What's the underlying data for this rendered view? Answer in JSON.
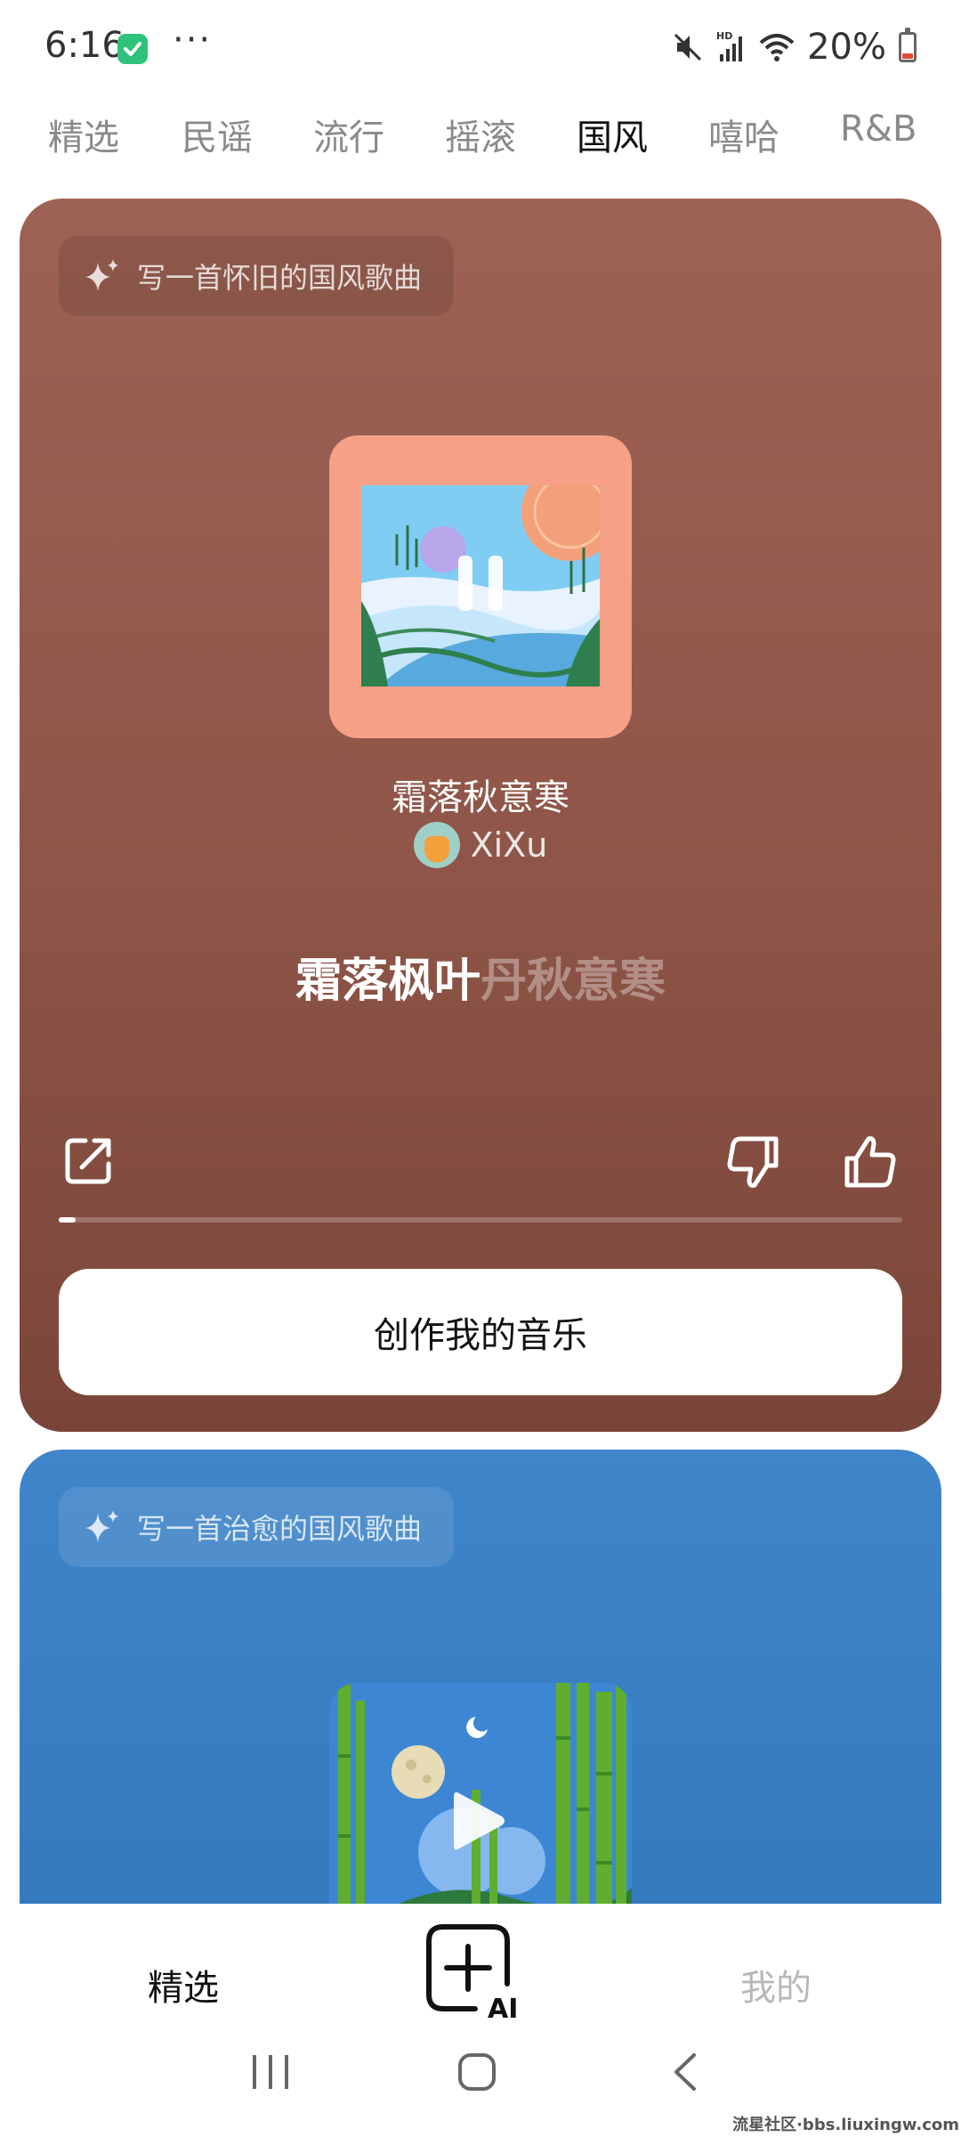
{
  "status_bar": {
    "time": "6:16",
    "more": "···",
    "battery": "20%",
    "icons": [
      "app-notification-icon",
      "mute-icon",
      "hd-signal-icon",
      "wifi-icon",
      "battery-icon"
    ],
    "battery_level": 0.2
  },
  "genre_tabs": [
    {
      "label": "精选"
    },
    {
      "label": "民谣"
    },
    {
      "label": "流行"
    },
    {
      "label": "摇滚"
    },
    {
      "label": "国风",
      "active": true
    },
    {
      "label": "嘻哈"
    },
    {
      "label": "R&B"
    }
  ],
  "cards": [
    {
      "prompt": "写一首怀旧的国风歌曲",
      "song_title": "霜落秋意寒",
      "artist": "XiXu",
      "lyric_sung": "霜落枫叶",
      "lyric_upcoming": "丹秋意寒",
      "state": "playing",
      "progress": 0.02,
      "create_button": "创作我的音乐",
      "background": "#9d6254"
    },
    {
      "prompt": "写一首治愈的国风歌曲",
      "state": "paused",
      "background": "#3f85c9"
    }
  ],
  "bottom_nav": {
    "featured": "精选",
    "create_badge": "AI",
    "mine": "我的"
  },
  "watermark": "流星社区·bbs.liuxingw.com"
}
